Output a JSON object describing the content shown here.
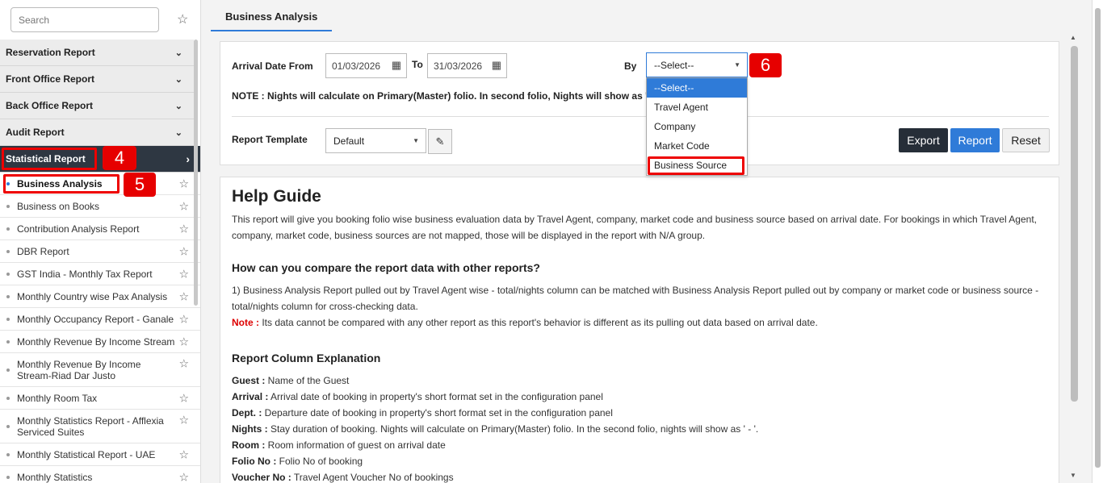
{
  "sidebar": {
    "search_placeholder": "Search",
    "groups": [
      {
        "label": "Reservation Report"
      },
      {
        "label": "Front Office Report"
      },
      {
        "label": "Back Office Report"
      },
      {
        "label": "Audit Report"
      },
      {
        "label": "Statistical Report"
      }
    ],
    "items": [
      {
        "label": "Business Analysis"
      },
      {
        "label": "Business on Books"
      },
      {
        "label": "Contribution Analysis Report"
      },
      {
        "label": "DBR Report"
      },
      {
        "label": "GST India - Monthly Tax Report"
      },
      {
        "label": "Monthly Country wise Pax Analysis"
      },
      {
        "label": "Monthly Occupancy Report - Ganale"
      },
      {
        "label": "Monthly Revenue By Income Stream"
      },
      {
        "label": "Monthly Revenue By Income Stream-Riad Dar Justo"
      },
      {
        "label": "Monthly Room Tax"
      },
      {
        "label": "Monthly Statistics Report - Afflexia Serviced Suites"
      },
      {
        "label": "Monthly Statistical Report - UAE"
      },
      {
        "label": "Monthly Statistics"
      }
    ]
  },
  "annotations": {
    "a4": "4",
    "a5": "5",
    "a6": "6"
  },
  "tab": {
    "label": "Business Analysis"
  },
  "filter": {
    "arrival_label": "Arrival Date From",
    "from_date": "01/03/2026",
    "to_label": "To",
    "to_date": "31/03/2026",
    "by_label": "By",
    "by_value": "--Select--",
    "by_options": [
      "--Select--",
      "Travel Agent",
      "Company",
      "Market Code",
      "Business Source"
    ],
    "note": "NOTE : Nights will calculate on Primary(Master) folio. In second folio, Nights will show as ' - '",
    "template_label": "Report Template",
    "template_value": "Default",
    "export": "Export",
    "report": "Report",
    "reset": "Reset"
  },
  "help": {
    "title": "Help Guide",
    "intro": "This report will give you booking folio wise business evaluation data by Travel Agent, company, market code and business source based on arrival date. For bookings in which Travel Agent, company, market code, business sources are not mapped, those will be displayed in the report with N/A group.",
    "compare_title": "How can you compare the report data with other reports?",
    "compare_text": "1) Business Analysis Report pulled out by Travel Agent wise - total/nights column can be matched with Business Analysis Report pulled out by company or market code or business source - total/nights column for cross-checking data.",
    "note_label": "Note :",
    "note_text": " Its data cannot be compared with any other report as this report's behavior is different as its pulling out data based on arrival date.",
    "columns_title": "Report Column Explanation",
    "columns": [
      {
        "k": "Guest :",
        "v": " Name of the Guest"
      },
      {
        "k": "Arrival :",
        "v": " Arrival date of booking in property's short format set in the configuration panel"
      },
      {
        "k": "Dept. :",
        "v": " Departure date of booking in property's short format set in the configuration panel"
      },
      {
        "k": "Nights :",
        "v": " Stay duration of booking. Nights will calculate on Primary(Master) folio. In the second folio, nights will show as ' - '."
      },
      {
        "k": "Room :",
        "v": " Room information of guest on arrival date"
      },
      {
        "k": "Folio No :",
        "v": " Folio No of booking"
      },
      {
        "k": "Voucher No :",
        "v": " Travel Agent Voucher No of bookings"
      }
    ]
  }
}
